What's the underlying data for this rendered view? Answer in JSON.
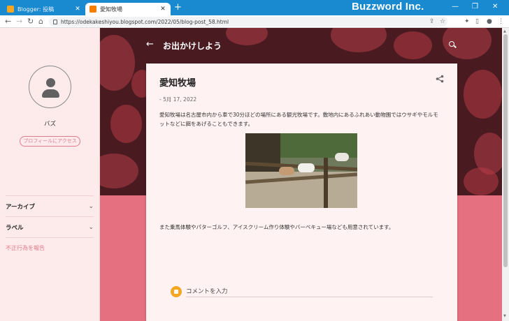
{
  "browser": {
    "tabs": [
      {
        "title": "Blogger: 投稿",
        "close": "✕"
      },
      {
        "title": "愛知牧場",
        "close": "✕"
      }
    ],
    "new_tab": "+",
    "brand": "Buzzword Inc.",
    "window_controls": {
      "minimize": "—",
      "restore": "❐",
      "close": "✕"
    },
    "url": "https://odekakeshiyou.blogspot.com/2022/05/blog-post_58.html",
    "nav": {
      "back": "←",
      "forward": "→",
      "reload": "↻",
      "home": "⌂"
    },
    "toolbar_icons": {
      "share": "⇪",
      "star": "☆",
      "extensions": "✦",
      "sidebar": "▯",
      "profile": "●",
      "menu": "⋮"
    }
  },
  "sidebar": {
    "username": "バズ",
    "profile_button": "プロフィールにアクセス",
    "sections": [
      {
        "label": "アーカイブ",
        "chevron": "⌄"
      },
      {
        "label": "ラベル",
        "chevron": "⌄"
      }
    ],
    "report_link": "不正行為を報告"
  },
  "blog": {
    "back": "←",
    "title": "お出かけしよう"
  },
  "post": {
    "title": "愛知牧場",
    "date": "- 5月 17, 2022",
    "paragraph1": "愛知牧場は名古屋市内から車で30分ほどの場所にある観光牧場です。敷地内にあるふれあい動物園ではウサギやモルモットなどに餌をあげることもできます。",
    "paragraph2": "また乗馬体験やパターゴルフ、アイスクリーム作り体験やバーベキュー場なども用意されています。",
    "comment_placeholder": "コメントを入力"
  },
  "colors": {
    "tabstrip": "#1a8ad0",
    "sidebar_bg": "#fdebec",
    "hero_bg": "#4a1a21",
    "main_bg": "#e5707f",
    "accent": "#e07a8a"
  }
}
